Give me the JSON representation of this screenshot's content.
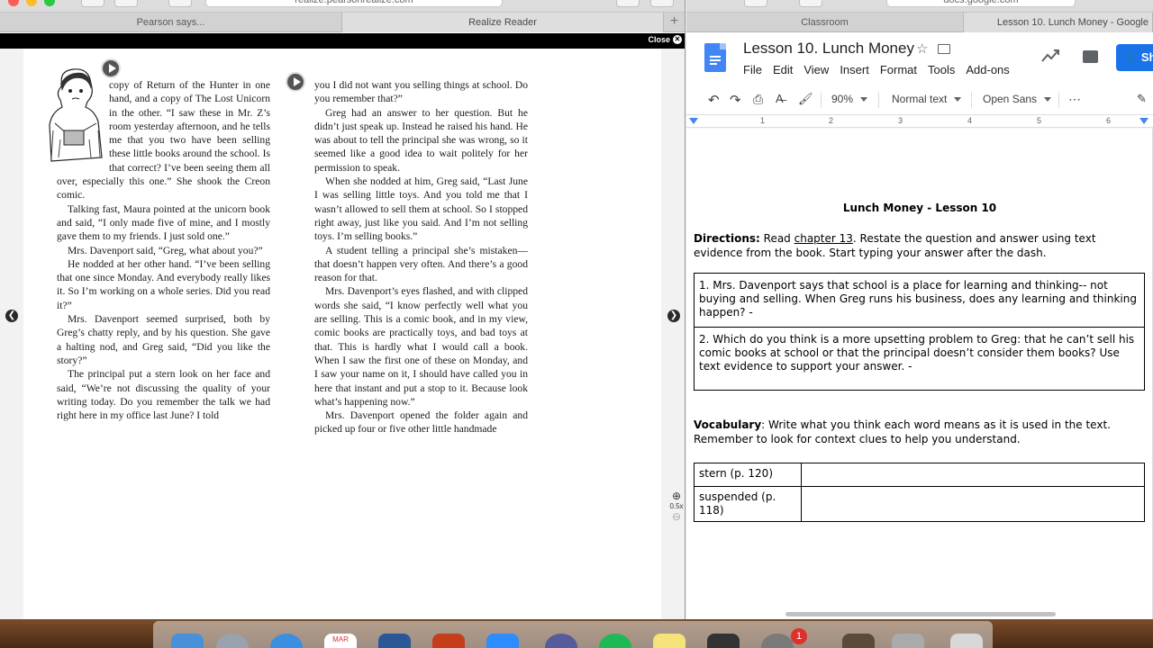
{
  "left_window": {
    "address_bar": "realize.pearsonrealize.com",
    "tabs": [
      {
        "label": "Pearson says..."
      },
      {
        "label": "Realize Reader"
      }
    ],
    "new_tab_icon": "plus-icon",
    "reader": {
      "close_label": "Close",
      "zoom_level": "0.5x",
      "column1": [
        {
          "text": "copy of Return of the Hunter in one hand, and a copy of The Lost Unicorn in the other. “I saw these in Mr. Z’s room yesterday afternoon, and he tells me that you two have been selling these little books around the school. Is that correct? I’ve been seeing them all over, especially this one.” She shook the Creon comic.",
          "indent": false
        },
        {
          "text": "Talking fast, Maura pointed at the unicorn book and said, “I only made five of mine, and I mostly gave them to my friends. I just sold one.”",
          "indent": true
        },
        {
          "text": "Mrs. Davenport said, “Greg, what about you?”",
          "indent": true
        },
        {
          "text": "He nodded at her other hand. “I’ve been selling that one since Monday. And everybody really likes it. So I’m working on a whole series. Did you read it?”",
          "indent": true
        },
        {
          "text": "Mrs. Davenport seemed surprised, both by Greg’s chatty reply, and by his question. She gave a halting nod, and Greg said, “Did you like the story?”",
          "indent": true
        },
        {
          "text": "The principal put a stern look on her face and said, “We’re not discussing the quality of your writing today. Do you remember the talk we had right here in my office last June? I told",
          "indent": true
        }
      ],
      "column2": [
        {
          "text": "you I did not want you selling things at school. Do you remember that?”",
          "indent": false
        },
        {
          "text": "Greg had an answer to her question. But he didn’t just speak up. Instead he raised his hand. He was about to tell the principal she was wrong, so it seemed like a good idea to wait politely for her permission to speak.",
          "indent": true
        },
        {
          "text": "When she nodded at him, Greg said, “Last June I was selling little toys. And you told me that I wasn’t allowed to sell them at school. So I stopped right away, just like you said. And I’m not selling toys. I’m selling books.”",
          "indent": true
        },
        {
          "text": "A student telling a principal she’s mistaken—that doesn’t happen very often. And there’s a good reason for that.",
          "indent": true
        },
        {
          "text": "Mrs. Davenport’s eyes flashed, and with clipped words she said, “I know perfectly well what you are selling. This is a comic book, and in my view, comic books are practically toys, and bad toys at that. This is hardly what I would call a book. When I saw the first one of these on Monday, and I saw your name on it, I should have called you in here that instant and put a stop to it. Because look what’s happening now.”",
          "indent": true
        },
        {
          "text": "Mrs. Davenport opened the folder again and picked up four or five other little handmade",
          "indent": true
        }
      ]
    }
  },
  "right_window": {
    "address_bar": "docs.google.com",
    "tabs": [
      {
        "label": "Classroom"
      },
      {
        "label": "Lesson 10. Lunch Money - Google"
      }
    ],
    "docs": {
      "title": "Lesson 10. Lunch Money",
      "menus": [
        "File",
        "Edit",
        "View",
        "Insert",
        "Format",
        "Tools",
        "Add-ons"
      ],
      "share_label": "Sh",
      "toolbar": {
        "zoom": "90%",
        "style": "Normal text",
        "font": "Open Sans",
        "more": "⋯"
      },
      "ruler_numbers": [
        "1",
        "2",
        "3",
        "4",
        "5",
        "6"
      ],
      "document": {
        "heading": "Lunch Money - Lesson 10",
        "directions_label": "Directions:",
        "directions_pre": " Read ",
        "directions_link": "chapter 13",
        "directions_post": ".  Restate the question and answer using text evidence from the book.  Start typing your answer after the dash.",
        "questions": [
          "1.   Mrs. Davenport says that school is a place for learning and thinking-- not buying and selling. When Greg runs his business, does any learning and thinking happen?  -",
          "2.   Which do you think is a more upsetting problem to Greg: that he can’t sell his comic books at school or that the principal doesn’t consider them books? Use text evidence to support your answer. -"
        ],
        "vocab_label": "Vocabulary",
        "vocab_text": ":  Write what you think each word means as it is used in the text.  Remember to look for context clues to help you understand.",
        "vocab_rows": [
          {
            "word": "stern (p. 120)",
            "meaning": ""
          },
          {
            "word": "suspended (p. 118)",
            "meaning": ""
          }
        ]
      }
    }
  },
  "dock": {
    "calendar_month": "MAR",
    "notification_badge": "1"
  }
}
